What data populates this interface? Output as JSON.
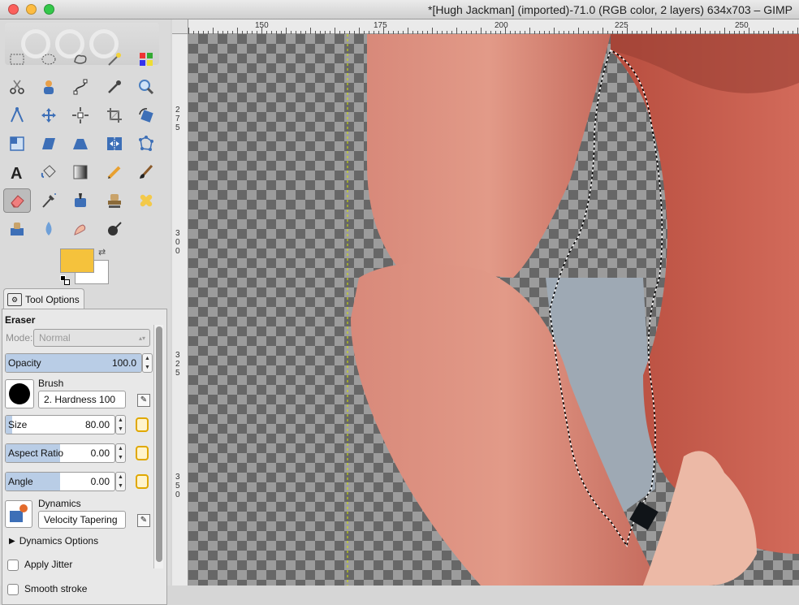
{
  "window": {
    "title": "*[Hugh Jackman] (imported)-71.0 (RGB color, 2 layers) 634x703 – GIMP",
    "traffic_lights": [
      "#fc605c",
      "#fdbc40",
      "#34c84a"
    ]
  },
  "toolbox": {
    "tools": [
      "rect-select-icon",
      "ellipse-select-icon",
      "free-select-icon",
      "fuzzy-select-icon",
      "color-select-icon",
      "scissors-select-icon",
      "foreground-select-icon",
      "paths-icon",
      "color-picker-icon",
      "zoom-icon",
      "measure-icon",
      "move-icon",
      "align-icon",
      "crop-icon",
      "rotate-icon",
      "scale-icon",
      "shear-icon",
      "perspective-icon",
      "flip-icon",
      "cage-transform-icon",
      "text-icon",
      "bucket-fill-icon",
      "blend-icon",
      "pencil-icon",
      "paintbrush-icon",
      "eraser-icon",
      "airbrush-icon",
      "ink-icon",
      "clone-icon",
      "heal-icon",
      "perspective-clone-icon",
      "blur-sharpen-icon",
      "smudge-icon",
      "dodge-burn-icon"
    ],
    "active_tool": "eraser-icon",
    "foreground_color": "#f5c23c",
    "background_color": "#ffffff"
  },
  "tool_options": {
    "tab_label": "Tool Options",
    "tool_name": "Eraser",
    "mode_label": "Mode:",
    "mode_value": "Normal",
    "opacity": {
      "label": "Opacity",
      "value": "100.0",
      "fraction": 1.0
    },
    "brush": {
      "label": "Brush",
      "value": "2. Hardness 100"
    },
    "size": {
      "label": "Size",
      "value": "80.00",
      "fraction": 0.06
    },
    "aspect_ratio": {
      "label": "Aspect Ratio",
      "value": "0.00",
      "fraction": 0.5
    },
    "angle": {
      "label": "Angle",
      "value": "0.00",
      "fraction": 0.5
    },
    "dynamics": {
      "label": "Dynamics",
      "value": "Velocity Tapering"
    },
    "dynamics_options": "Dynamics Options",
    "apply_jitter": "Apply Jitter",
    "smooth_stroke": "Smooth stroke"
  },
  "rulers": {
    "top": [
      "150",
      "175",
      "200",
      "225",
      "250"
    ],
    "left": [
      "275",
      "300",
      "325",
      "350"
    ]
  }
}
